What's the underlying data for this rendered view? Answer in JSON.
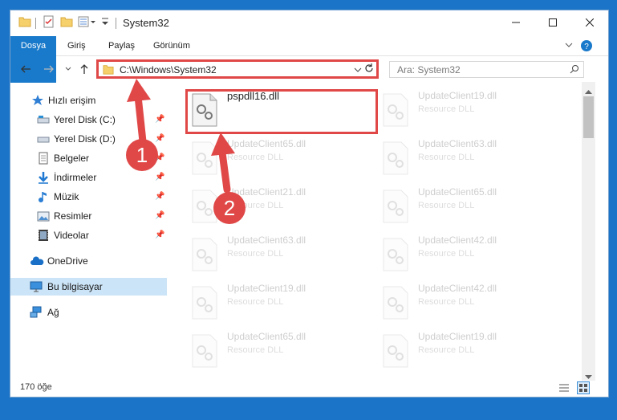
{
  "window": {
    "title": "System32"
  },
  "ribbon": {
    "tabs": [
      "Dosya",
      "Giriş",
      "Paylaş",
      "Görünüm"
    ]
  },
  "address": {
    "path": "C:\\Windows\\System32"
  },
  "search": {
    "placeholder": "Ara: System32"
  },
  "sidebar": {
    "quick_access": "Hızlı erişim",
    "items": [
      {
        "label": "Yerel Disk (C:)",
        "icon": "drive-icon"
      },
      {
        "label": "Yerel Disk (D:)",
        "icon": "drive-icon"
      },
      {
        "label": "Belgeler",
        "icon": "documents-icon"
      },
      {
        "label": "İndirmeler",
        "icon": "download-icon"
      },
      {
        "label": "Müzik",
        "icon": "music-icon"
      },
      {
        "label": "Resimler",
        "icon": "pictures-icon"
      },
      {
        "label": "Videolar",
        "icon": "videos-icon"
      }
    ],
    "onedrive": "OneDrive",
    "this_pc": "Bu bilgisayar",
    "network": "Ağ"
  },
  "files": [
    {
      "name": "pspdll16.dll",
      "type": ""
    },
    {
      "name": "UpdateClient19.dll",
      "type": "Resource DLL"
    },
    {
      "name": "UpdateClient65.dll",
      "type": "Resource DLL"
    },
    {
      "name": "UpdateClient63.dll",
      "type": "Resource DLL"
    },
    {
      "name": "UpdateClient21.dll",
      "type": "Resource DLL"
    },
    {
      "name": "UpdateClient65.dll",
      "type": "Resource DLL"
    },
    {
      "name": "UpdateClient63.dll",
      "type": "Resource DLL"
    },
    {
      "name": "UpdateClient42.dll",
      "type": "Resource DLL"
    },
    {
      "name": "UpdateClient19.dll",
      "type": "Resource DLL"
    },
    {
      "name": "UpdateClient42.dll",
      "type": "Resource DLL"
    },
    {
      "name": "UpdateClient65.dll",
      "type": "Resource DLL"
    },
    {
      "name": "UpdateClient19.dll",
      "type": "Resource DLL"
    }
  ],
  "status": {
    "count": "170 öğe"
  },
  "annotations": {
    "step1": "1",
    "step2": "2"
  },
  "colors": {
    "accent": "#1979ca",
    "highlight": "#e04848",
    "selection": "#cce4f7"
  }
}
